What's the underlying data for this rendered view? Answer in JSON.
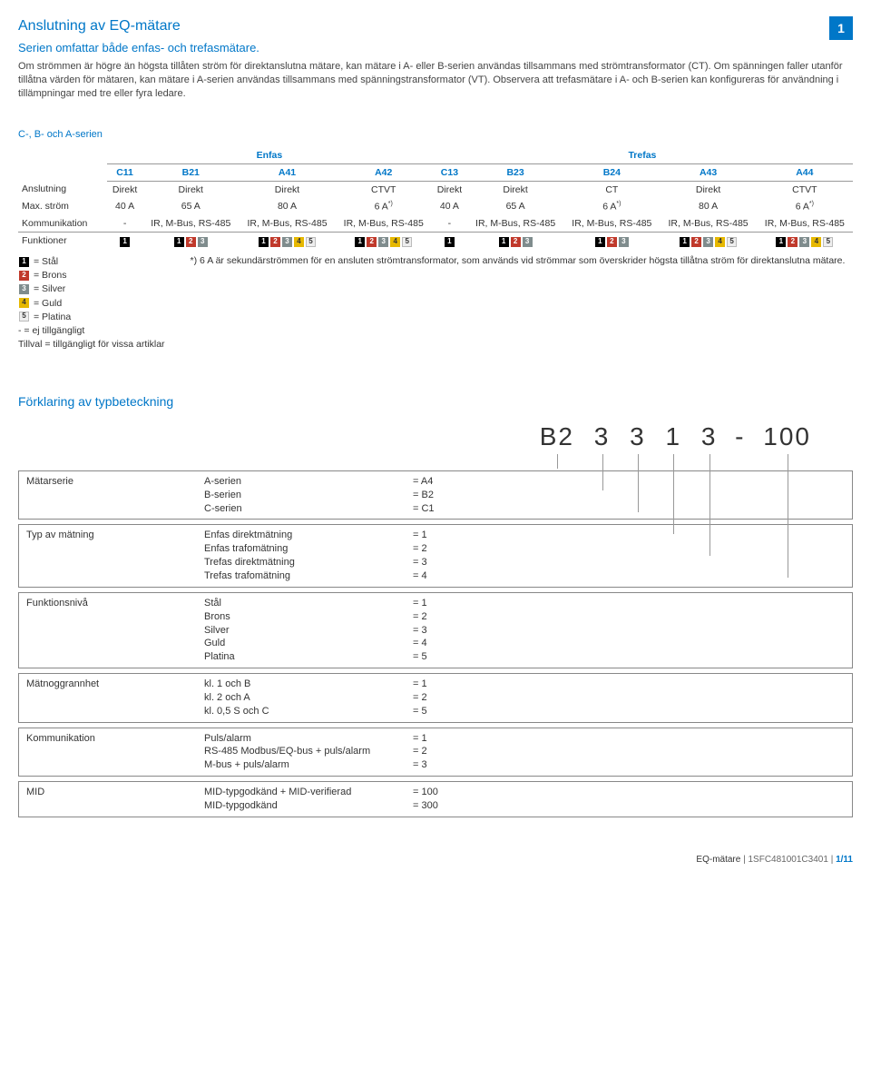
{
  "page_badge": "1",
  "title": "Anslutning av EQ-mätare",
  "subtitle": "Serien omfattar både enfas- och trefasmätare.",
  "intro": "Om strömmen är högre än högsta tillåten ström för direktanslutna mätare, kan mätare i A- eller B-serien användas tillsammans med strömtransformator (CT). Om spänningen faller utanför tillåtna värden för mätaren, kan mätare i A-serien användas tillsammans med spänningstransformator (VT). Observera att trefasmätare i A- och B-serien kan konfigureras för användning i tillämpningar med tre eller fyra ledare.",
  "series_heading": "C-, B- och A-serien",
  "phase_headers": {
    "enfas": "Enfas",
    "trefas": "Trefas"
  },
  "columns": [
    "C11",
    "B21",
    "A41",
    "A42",
    "C13",
    "B23",
    "B24",
    "A43",
    "A44"
  ],
  "rows": {
    "anslutning": {
      "label": "Anslutning",
      "vals": [
        "Direkt",
        "Direkt",
        "Direkt",
        "CTVT",
        "Direkt",
        "Direkt",
        "CT",
        "Direkt",
        "CTVT"
      ]
    },
    "maxstrom": {
      "label": "Max. ström",
      "vals": [
        "40 A",
        "65 A",
        "80 A",
        "6 A*)",
        "40 A",
        "65 A",
        "6 A*)",
        "80 A",
        "6 A*)"
      ]
    },
    "komm": {
      "label": "Kommunikation",
      "vals": [
        "-",
        "IR, M-Bus, RS-485",
        "IR, M-Bus, RS-485",
        "IR, M-Bus, RS-485",
        "-",
        "IR, M-Bus, RS-485",
        "IR, M-Bus, RS-485",
        "IR, M-Bus, RS-485",
        "IR, M-Bus, RS-485"
      ]
    },
    "funktioner": {
      "label": "Funktioner"
    }
  },
  "funktioner_levels": [
    [
      1
    ],
    [
      1,
      2,
      3
    ],
    [
      1,
      2,
      3,
      4,
      5
    ],
    [
      1,
      2,
      3,
      4,
      5
    ],
    [
      1
    ],
    [
      1,
      2,
      3
    ],
    [
      1,
      2,
      3
    ],
    [
      1,
      2,
      3,
      4,
      5
    ],
    [
      1,
      2,
      3,
      4,
      5
    ]
  ],
  "legend": {
    "items": [
      {
        "n": "1",
        "cls": "c1",
        "text": "= Stål"
      },
      {
        "n": "2",
        "cls": "c2",
        "text": "= Brons"
      },
      {
        "n": "3",
        "cls": "c3",
        "text": "= Silver"
      },
      {
        "n": "4",
        "cls": "c4",
        "text": "= Guld"
      },
      {
        "n": "5",
        "cls": "c5",
        "text": "= Platina"
      }
    ],
    "dash": "- = ej tillgängligt",
    "tillval": "Tillval = tillgängligt för vissa artiklar"
  },
  "note_star": "*) 6 A är sekundärströmmen för en ansluten strömtransformator, som används vid strömmar som överskrider högsta tillåtna ström för direktanslutna mätare.",
  "decode_heading": "Förklaring av typbetckning",
  "decode_heading_fixed": "Förklaring av typbeteckning",
  "big_code": [
    "B2",
    "3",
    "3",
    "1",
    "3",
    "-",
    "100"
  ],
  "decode_blocks": [
    {
      "label": "Mätarserie",
      "pairs": [
        [
          "A-serien",
          "= A4"
        ],
        [
          "B-serien",
          "= B2"
        ],
        [
          "C-serien",
          "= C1"
        ]
      ]
    },
    {
      "label": "Typ av mätning",
      "pairs": [
        [
          "Enfas direktmätning",
          "= 1"
        ],
        [
          "Enfas trafomätning",
          "= 2"
        ],
        [
          "Trefas direktmätning",
          "= 3"
        ],
        [
          "Trefas trafomätning",
          "= 4"
        ]
      ]
    },
    {
      "label": "Funktionsnivå",
      "pairs": [
        [
          "Stål",
          "= 1"
        ],
        [
          "Brons",
          "= 2"
        ],
        [
          "Silver",
          "= 3"
        ],
        [
          "Guld",
          "= 4"
        ],
        [
          "Platina",
          "= 5"
        ]
      ]
    },
    {
      "label": "Mätnoggrannhet",
      "pairs": [
        [
          "kl. 1 och B",
          "= 1"
        ],
        [
          "kl. 2 och A",
          "= 2"
        ],
        [
          "kl. 0,5 S och C",
          "= 5"
        ]
      ]
    },
    {
      "label": "Kommunikation",
      "pairs": [
        [
          "Puls/alarm",
          "= 1"
        ],
        [
          "RS-485 Modbus/EQ-bus + puls/alarm",
          "= 2"
        ],
        [
          "M-bus + puls/alarm",
          "= 3"
        ]
      ]
    },
    {
      "label": "MID",
      "pairs": [
        [
          "MID-typgodkänd + MID-verifierad",
          "= 100"
        ],
        [
          "MID-typgodkänd",
          "= 300"
        ]
      ]
    }
  ],
  "footer": {
    "product": "EQ-mätare",
    "doc": "1SFC481001C3401",
    "page": "1/11"
  },
  "chart_data": {
    "type": "table",
    "title": "C-, B- och A-serien",
    "categories": [
      "C11",
      "B21",
      "A41",
      "A42",
      "C13",
      "B23",
      "B24",
      "A43",
      "A44"
    ],
    "series": [
      {
        "name": "Anslutning",
        "values": [
          "Direkt",
          "Direkt",
          "Direkt",
          "CTVT",
          "Direkt",
          "Direkt",
          "CT",
          "Direkt",
          "CTVT"
        ]
      },
      {
        "name": "Max. ström",
        "values": [
          "40 A",
          "65 A",
          "80 A",
          "6 A*",
          "40 A",
          "65 A",
          "6 A*",
          "80 A",
          "6 A*"
        ]
      },
      {
        "name": "Kommunikation",
        "values": [
          "-",
          "IR, M-Bus, RS-485",
          "IR, M-Bus, RS-485",
          "IR, M-Bus, RS-485",
          "-",
          "IR, M-Bus, RS-485",
          "IR, M-Bus, RS-485",
          "IR, M-Bus, RS-485",
          "IR, M-Bus, RS-485"
        ]
      },
      {
        "name": "Funktioner (nivåer)",
        "values": [
          1,
          3,
          5,
          5,
          1,
          3,
          3,
          5,
          5
        ]
      }
    ]
  }
}
